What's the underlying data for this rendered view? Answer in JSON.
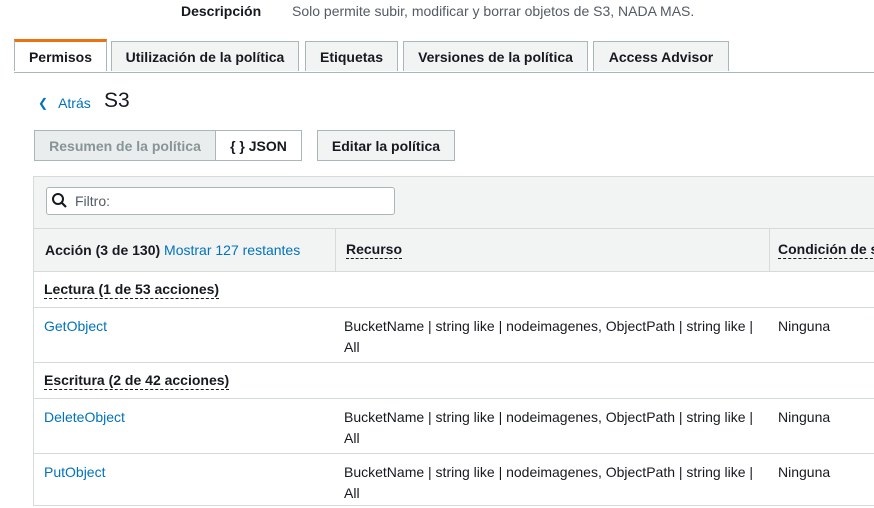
{
  "description": {
    "label": "Descripción",
    "value": "Solo permite subir, modificar y borrar objetos de S3, NADA MAS."
  },
  "tabs": [
    {
      "label": "Permisos",
      "active": true
    },
    {
      "label": "Utilización de la política",
      "active": false
    },
    {
      "label": "Etiquetas",
      "active": false
    },
    {
      "label": "Versiones de la política",
      "active": false
    },
    {
      "label": "Access Advisor",
      "active": false
    }
  ],
  "nav": {
    "back_label": "Atrás",
    "page_title": "S3"
  },
  "toolbar": {
    "summary_label": "Resumen de la política",
    "json_label": "{ } JSON",
    "edit_label": "Editar la política"
  },
  "filter": {
    "placeholder": "Filtro:",
    "value": ""
  },
  "table": {
    "headers": {
      "action": "Acción (3 de 130)",
      "show_remaining": "Mostrar 127 restantes",
      "resource": "Recurso",
      "condition": "Condición de s"
    },
    "groups": [
      {
        "label": "Lectura (1 de 53 acciones)",
        "rows": [
          {
            "action": "GetObject",
            "resource": "BucketName | string like | nodeimagenes, ObjectPath | string like | All",
            "condition": "Ninguna"
          }
        ]
      },
      {
        "label": "Escritura (2 de 42 acciones)",
        "rows": [
          {
            "action": "DeleteObject",
            "resource": "BucketName | string like | nodeimagenes, ObjectPath | string like | All",
            "condition": "Ninguna"
          },
          {
            "action": "PutObject",
            "resource": "BucketName | string like | nodeimagenes, ObjectPath | string like | All",
            "condition": "Ninguna"
          }
        ]
      }
    ]
  },
  "colors": {
    "link": "#0073bb",
    "active_tab_accent": "#ec7211",
    "header_bg": "#f2f3f3"
  }
}
